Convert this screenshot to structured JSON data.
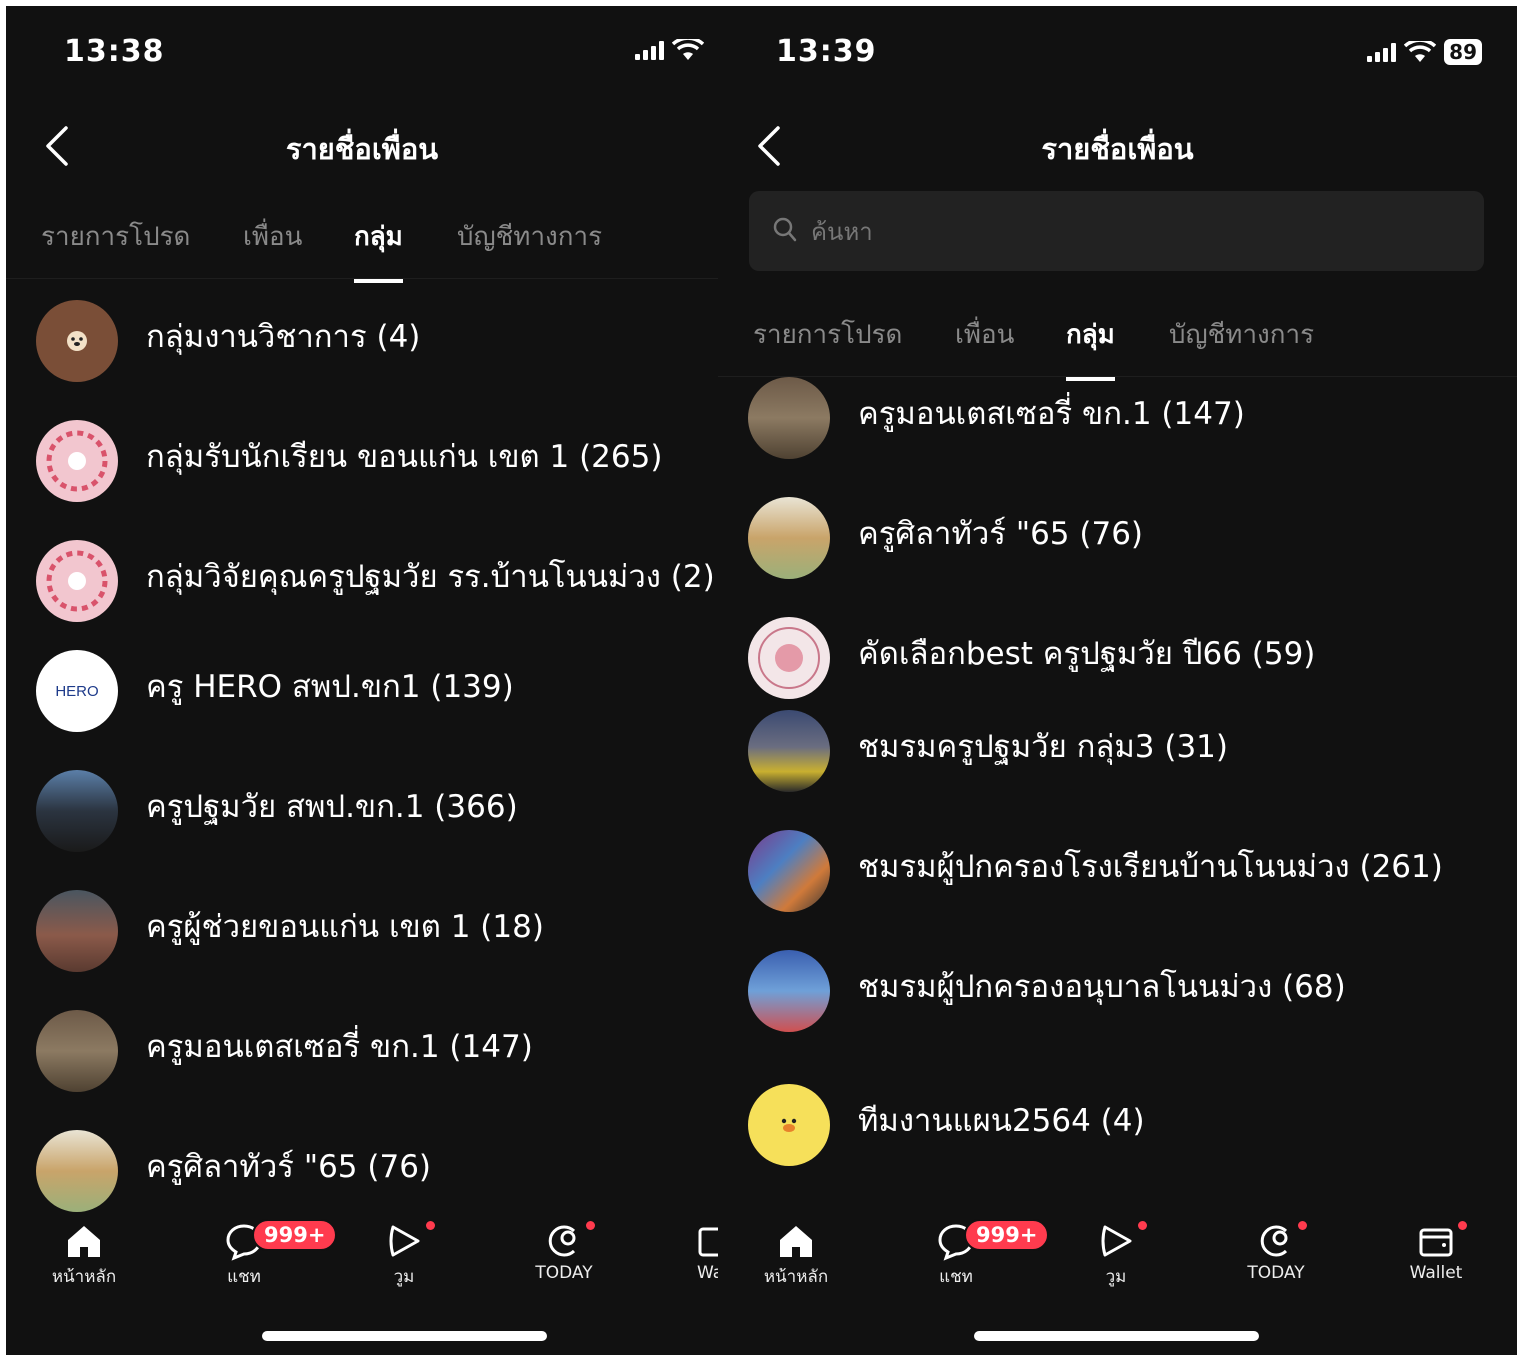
{
  "left": {
    "time": "13:38",
    "title": "รายชื่อเพื่อน",
    "tabs": [
      "รายการโปรด",
      "เพื่อน",
      "กลุ่ม",
      "บัญชีทางการ"
    ],
    "groups": [
      "กลุ่มงานวิชาการ (4)",
      "กลุ่มรับนักเรียน ขอนแก่น เขต 1 (265)",
      "กลุ่มวิจัยคุณครูปฐมวัย รร.บ้านโนนม่วง (2)",
      "ครู HERO สพป.ขก1 (139)",
      "ครูปฐมวัย สพป.ขก.1 (366)",
      "ครูผู้ช่วยขอนแก่น เขต 1 (18)",
      "ครูมอนเตสเซอรี่ ขก.1 (147)",
      "ครูศิลาทัวร์ \"65 (76)"
    ],
    "hero_avatar_text": "HERO",
    "tabbar": {
      "home": "หน้าหลัก",
      "chat": "แชท",
      "voom": "วูม",
      "today": "TODAY",
      "wallet": "Wa"
    }
  },
  "right": {
    "time": "13:39",
    "battery": "89",
    "title": "รายชื่อเพื่อน",
    "search_placeholder": "ค้นหา",
    "tabs": [
      "รายการโปรด",
      "เพื่อน",
      "กลุ่ม",
      "บัญชีทางการ"
    ],
    "groups": [
      "ครูมอนเตสเซอรี่ ขก.1 (147)",
      "ครูศิลาทัวร์ \"65 (76)",
      "คัดเลือกbest ครูปฐมวัย ปี66 (59)",
      "ชมรมครูปฐมวัย กลุ่ม3 (31)",
      "ชมรมผู้ปกครองโรงเรียนบ้านโนนม่วง (261)",
      "ชมรมผู้ปกครองอนุบาลโนนม่วง (68)",
      "ทีมงานแผน2564 (4)"
    ],
    "tabbar": {
      "home": "หน้าหลัก",
      "chat": "แชท",
      "voom": "วูม",
      "today": "TODAY",
      "wallet": "Wallet"
    }
  },
  "chat_badge": "999+",
  "colors": {
    "background": "#111111",
    "badge": "#ff3b4e",
    "inactive_tab": "#8a8a8a"
  }
}
